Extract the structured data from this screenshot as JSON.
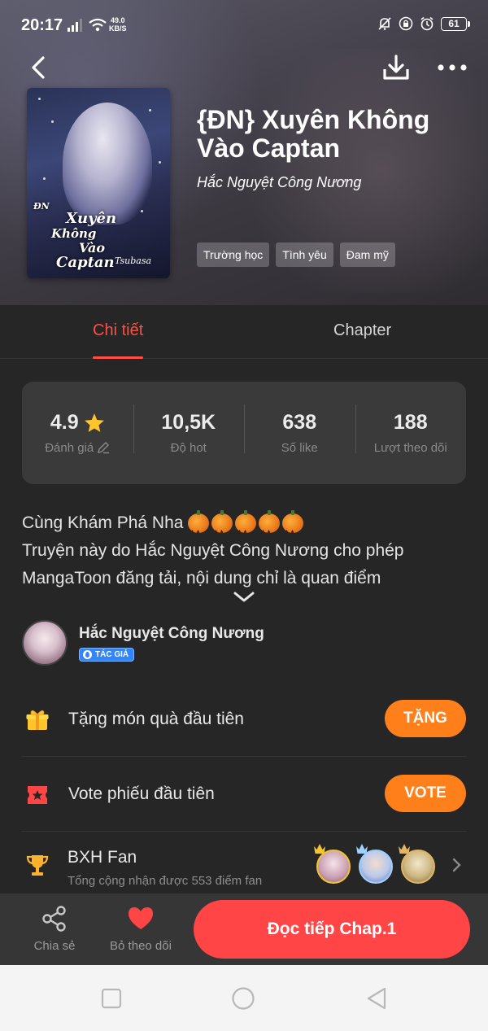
{
  "status_bar": {
    "time": "20:17",
    "net_speed_value": "49.0",
    "net_speed_unit": "KB/S",
    "battery": "61"
  },
  "header": {
    "title": "{ĐN} Xuyên Không Vào Captan",
    "author": "Hắc Nguyệt Công Nương",
    "tags": [
      "Trường học",
      "Tình yêu",
      "Đam mỹ"
    ]
  },
  "cover_art": {
    "line1": "ĐN",
    "line2": "Xuyên",
    "line3": "Không",
    "line4": "Vào",
    "line5": "Captan",
    "subtitle": "Tsubasa"
  },
  "tabs": {
    "detail": "Chi tiết",
    "chapter": "Chapter"
  },
  "stats": {
    "rating_value": "4.9",
    "rating_label": "Đánh giá",
    "hot_value": "10,5K",
    "hot_label": "Độ hot",
    "likes_value": "638",
    "likes_label": "Số like",
    "followers_value": "188",
    "followers_label": "Lượt theo dõi"
  },
  "description": {
    "line1": "Cùng Khám Phá Nha",
    "line2": "Truyện này do Hắc Nguyệt Công Nương cho phép",
    "line3": "MangaToon đăng tải, nội dung chỉ là quan điểm"
  },
  "author_card": {
    "name": "Hắc Nguyệt Công Nương",
    "badge": "TÁC GIẢ"
  },
  "actions": {
    "gift_label": "Tặng món quà đầu tiên",
    "gift_button": "TẶNG",
    "vote_label": "Vote phiếu đầu tiên",
    "vote_button": "VOTE",
    "fan_label": "BXH Fan",
    "fan_sub": "Tổng cộng nhận được 553 điểm fan"
  },
  "bottom_bar": {
    "share": "Chia sẻ",
    "unfollow": "Bỏ theo dõi",
    "read": "Đọc tiếp Chap.1"
  },
  "colors": {
    "accent": "#ff4545",
    "tab_active": "#ff4f45",
    "action_button": "#ff7f1a",
    "badge_blue": "#2f86ff",
    "star": "#ffc52b"
  }
}
